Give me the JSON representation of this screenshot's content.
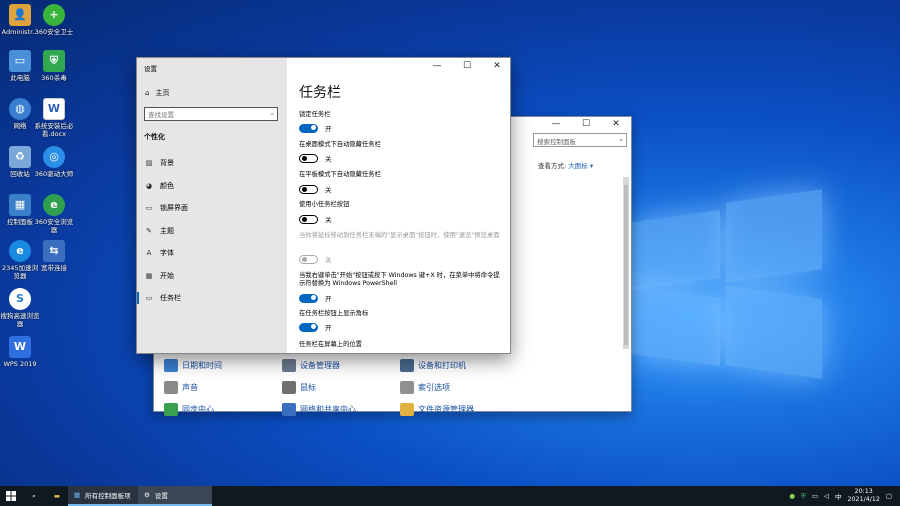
{
  "desktop": {
    "icons": [
      {
        "label": "Administr...",
        "color": "#e0a23a"
      },
      {
        "label": "360安全卫士",
        "color": "#3ab43a"
      },
      {
        "label": "此电脑",
        "color": "#4a90d9"
      },
      {
        "label": "360杀毒",
        "color": "#2fa84f"
      },
      {
        "label": "网络",
        "color": "#3a7fd0"
      },
      {
        "label": "系统安装后必看.docx",
        "color": "#2b5fb8"
      },
      {
        "label": "回收站",
        "color": "#7aa6d8"
      },
      {
        "label": "360驱动大师",
        "color": "#2a8fe8"
      },
      {
        "label": "控制面板",
        "color": "#3a80c8"
      },
      {
        "label": "360安全浏览器",
        "color": "#30a050"
      },
      {
        "label": "2345加速浏览器",
        "color": "#1a8ae0"
      },
      {
        "label": "宽带连接",
        "color": "#3a6fc0"
      },
      {
        "label": "搜狗高速浏览器",
        "color": "#2a7fd8"
      },
      {
        "label": "WPS 2019",
        "color": "#2f6fe0"
      }
    ]
  },
  "control_panel": {
    "search_placeholder": "搜索控制面板",
    "view_label": "查看方式:",
    "view_value": "大图标 ▾",
    "items": [
      {
        "label": "日期和时间",
        "color": "#3a7fd0"
      },
      {
        "label": "设备管理器",
        "color": "#6a7a90"
      },
      {
        "label": "设备和打印机",
        "color": "#4a6a90"
      },
      {
        "label": "声音",
        "color": "#8a8a8a"
      },
      {
        "label": "鼠标",
        "color": "#707070"
      },
      {
        "label": "索引选项",
        "color": "#909090"
      },
      {
        "label": "同步中心",
        "color": "#3aa050"
      },
      {
        "label": "网络和共享中心",
        "color": "#3a6fc0"
      },
      {
        "label": "文件资源管理器",
        "color": "#e0b040"
      }
    ]
  },
  "settings": {
    "window_title": "设置",
    "home_label": "主页",
    "search_placeholder": "查找设置",
    "category": "个性化",
    "nav": [
      {
        "icon": "image-icon",
        "label": "背景"
      },
      {
        "icon": "palette-icon",
        "label": "颜色"
      },
      {
        "icon": "lockscreen-icon",
        "label": "锁屏界面"
      },
      {
        "icon": "theme-icon",
        "label": "主题"
      },
      {
        "icon": "font-icon",
        "label": "字体"
      },
      {
        "icon": "start-icon",
        "label": "开始"
      },
      {
        "icon": "taskbar-icon",
        "label": "任务栏"
      }
    ],
    "page_title": "任务栏",
    "options": {
      "lock_taskbar": {
        "label": "锁定任务栏",
        "state": "开"
      },
      "autohide_desktop": {
        "label": "在桌面模式下自动隐藏任务栏",
        "state": "关"
      },
      "autohide_tablet": {
        "label": "在平板模式下自动隐藏任务栏",
        "state": "关"
      },
      "small_buttons": {
        "label": "使用小任务栏按钮",
        "state": "关"
      },
      "peek": {
        "label": "当你将鼠标移动到任务栏末端的\"显示桌面\"按钮时，使用\"速览\"预览桌面",
        "state": "关"
      },
      "powershell": {
        "label": "当我右键单击\"开始\"按钮或按下 Windows 键+X 时，在菜单中将命令提示符替换为 Windows PowerShell",
        "state": "开"
      },
      "badges": {
        "label": "在任务栏按钮上显示角标",
        "state": "开"
      },
      "location": {
        "label": "任务栏在屏幕上的位置"
      }
    }
  },
  "taskbar": {
    "apps": [
      {
        "label": "所有控制面板项"
      },
      {
        "label": "设置"
      }
    ],
    "time": "20:13",
    "date": "2021/4/12"
  }
}
